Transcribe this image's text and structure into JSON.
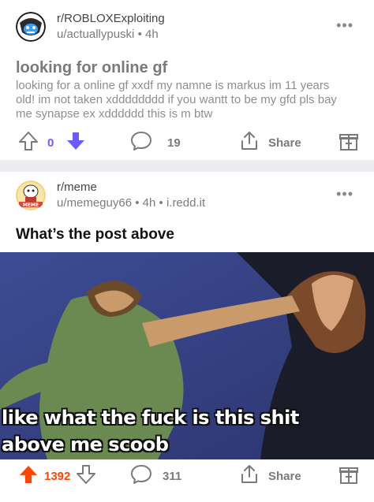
{
  "posts": [
    {
      "subreddit": "r/ROBLOXExploiting",
      "username": "u/actuallypuski",
      "time": "4h",
      "title": "looking for online gf",
      "body": "looking for a online gf xxdf  my namne is markus im 11 years old! im not taken xdddddddd if you wantt to be my gfd pls bay me synapse ex xdddddd this is m btw",
      "votes": "0",
      "comments": "19",
      "share_label": "Share",
      "vote_state": "downvoted"
    },
    {
      "subreddit": "r/meme",
      "username": "u/memeguy66",
      "time": "4h",
      "domain": "i.redd.it",
      "title": "What’s the post above",
      "meme_caption_line1": "like what the fuck is this shit",
      "meme_caption_line2": "above me scoob",
      "votes": "1392",
      "comments": "311",
      "share_label": "Share",
      "vote_state": "upvoted"
    }
  ],
  "icons": {
    "more": "more-options-icon",
    "upvote": "upvote-arrow-icon",
    "downvote": "downvote-arrow-icon",
    "comment": "comment-bubble-icon",
    "share": "share-icon",
    "award": "award-gift-icon"
  },
  "colors": {
    "upvote": "#ff4500",
    "downvote": "#6a5cff",
    "meta_gray": "#7c7c7c",
    "separator": "#ececf0"
  }
}
